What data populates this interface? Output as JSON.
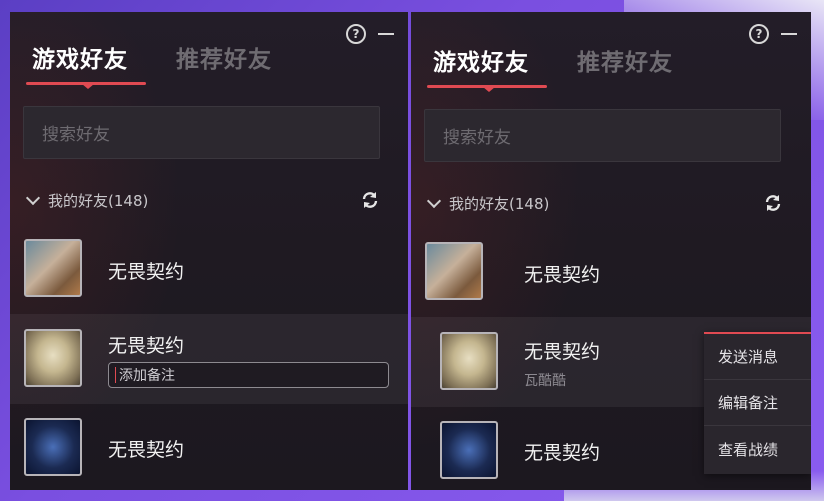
{
  "panels": [
    {
      "tabs": [
        "游戏好友",
        "推荐好友"
      ],
      "search_placeholder": "搜索好友",
      "group_label": "我的好友(148)",
      "friends": [
        {
          "name": "无畏契约"
        },
        {
          "name": "无畏契约",
          "remark_placeholder": "添加备注"
        },
        {
          "name": "无畏契约"
        }
      ]
    },
    {
      "tabs": [
        "游戏好友",
        "推荐好友"
      ],
      "search_placeholder": "搜索好友",
      "group_label": "我的好友(148)",
      "friends": [
        {
          "name": "无畏契约"
        },
        {
          "name": "无畏契约",
          "subtext": "瓦酷酷"
        },
        {
          "name": "无畏契约"
        }
      ],
      "context_menu": [
        "发送消息",
        "编辑备注",
        "查看战绩"
      ]
    }
  ],
  "colors": {
    "accent": "#e04a52",
    "panel_bg": "#1f1a22"
  }
}
